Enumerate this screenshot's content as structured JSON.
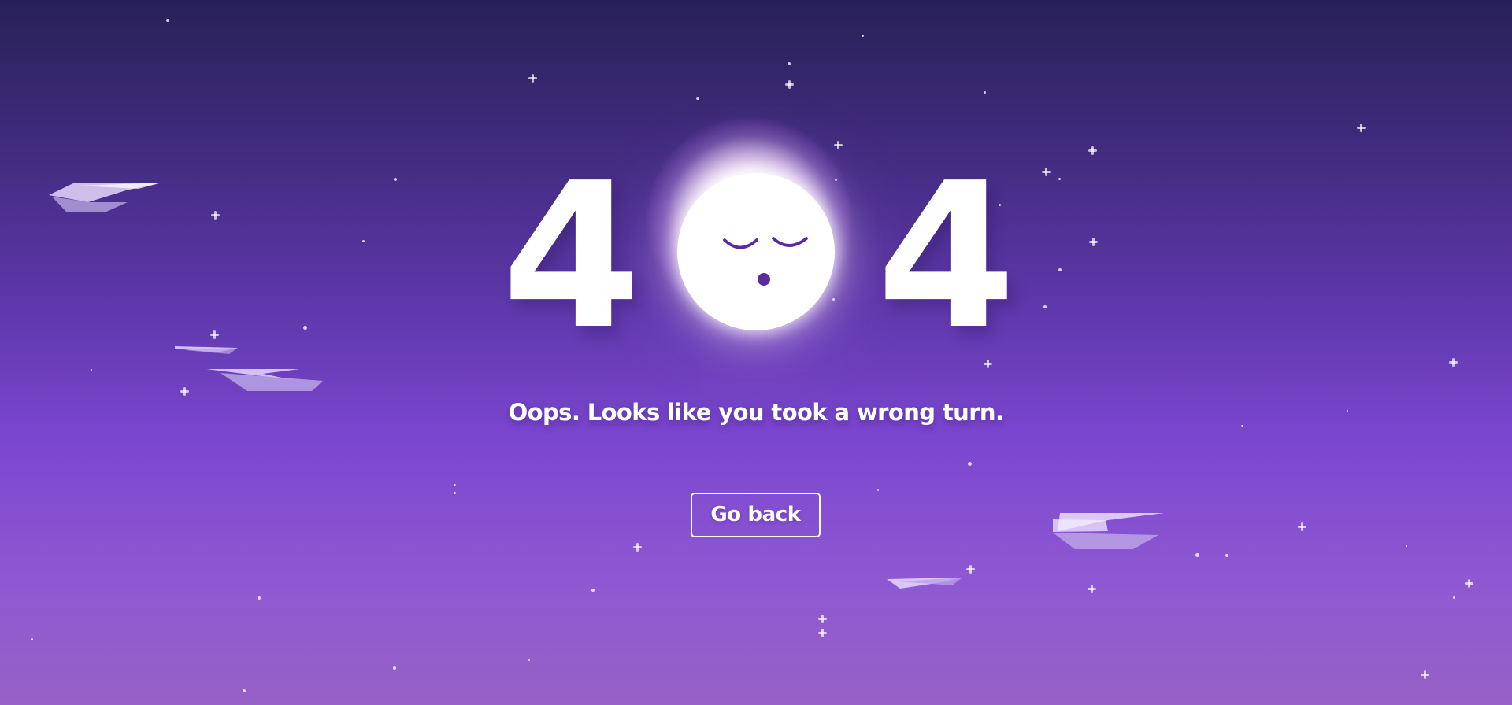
{
  "page": {
    "message": "Oops. Looks like you took a wrong turn.",
    "action": "Go back"
  },
  "hero": {
    "digit_left": "4",
    "digit_right": "4"
  },
  "icons": {
    "moon": "sleeping-moon-icon",
    "plane": "paper-airplane-icon",
    "sparkle": "sparkle-icon"
  },
  "colors": {
    "background_top": "#282157",
    "background_middle": "#7a46cf",
    "background_bottom": "#9761c7",
    "foreground": "#ffffff",
    "face": "#5b2aa0"
  }
}
